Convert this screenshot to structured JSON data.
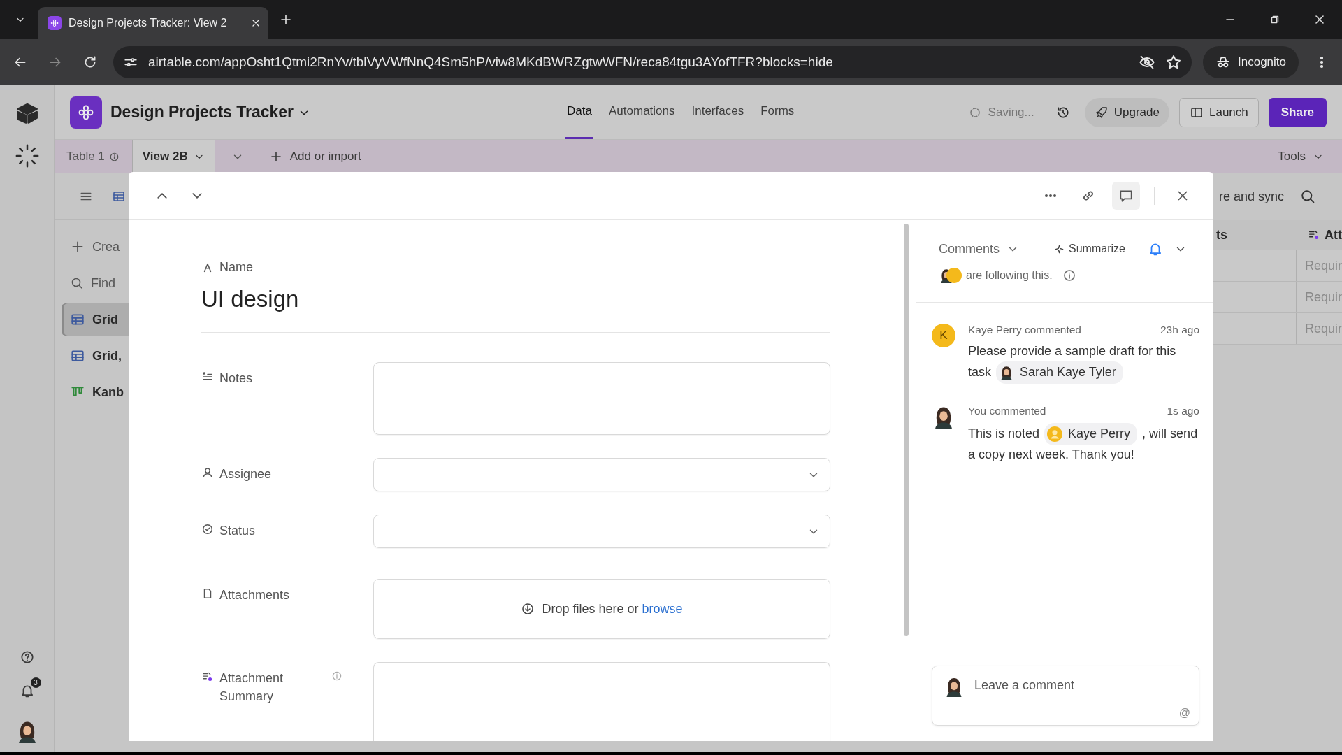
{
  "browser": {
    "tab_title": "Design Projects Tracker: View 2",
    "url": "airtable.com/appOsht1Qtmi2RnYv/tblVyVWfNnQ4Sm5hP/viw8MKdBWRZgtwWFN/reca84tgu3AYofTFR?blocks=hide",
    "profile": "Incognito"
  },
  "rail": {
    "notification_count": "3"
  },
  "app": {
    "title": "Design Projects Tracker",
    "nav": [
      {
        "label": "Data",
        "selected": true
      },
      {
        "label": "Automations",
        "selected": false
      },
      {
        "label": "Interfaces",
        "selected": false
      },
      {
        "label": "Forms",
        "selected": false
      }
    ],
    "status": "Saving...",
    "upgrade": "Upgrade",
    "launch": "Launch",
    "share": "Share"
  },
  "table_bar": {
    "table": "Table 1",
    "view": "View 2B",
    "add": "Add or import",
    "tools": "Tools"
  },
  "view_sidebar": {
    "create": "Crea",
    "find_placeholder": "Find",
    "views": [
      {
        "label": "Grid",
        "kind": "grid",
        "selected": true
      },
      {
        "label": "Grid,",
        "kind": "grid",
        "selected": false
      },
      {
        "label": "Kanb",
        "kind": "kanban",
        "selected": false
      }
    ]
  },
  "grid_behind": {
    "toolbar_text": "re and sync",
    "columns": [
      "ts",
      "Att"
    ],
    "cells": [
      "Requir",
      "Requir",
      "Requir"
    ]
  },
  "record": {
    "name_label": "Name",
    "name": "UI design",
    "fields": [
      {
        "label": "Notes",
        "kind": "long_text"
      },
      {
        "label": "Assignee",
        "kind": "user"
      },
      {
        "label": "Status",
        "kind": "status"
      },
      {
        "label": "Attachments",
        "kind": "attachment",
        "drop_text": "Drop files here or",
        "link": "browse"
      },
      {
        "label": "Attachment Summary",
        "kind": "ai_text"
      }
    ]
  },
  "comments": {
    "view": "Comments",
    "summarize": "Summarize",
    "followers": [
      {
        "kind": "photo"
      },
      {
        "kind": "blank"
      }
    ],
    "following_text": "are following this.",
    "items": [
      {
        "avatar": {
          "kind": "initial",
          "initial": "K"
        },
        "author": "Kaye Perry commented",
        "time": "23h ago",
        "before": "Please provide a sample draft for this task",
        "mention": "Sarah Kaye Tyler",
        "mention_avatar": {
          "kind": "photo"
        }
      },
      {
        "avatar": {
          "kind": "photo"
        },
        "author": "You commented",
        "time": "1s ago",
        "before": "This is noted",
        "mention": "Kaye Perry",
        "mention_avatar": {
          "kind": "placeholder"
        },
        "after": ", will send a copy next week. Thank you!"
      }
    ],
    "composer_placeholder": "Leave a comment",
    "mention_key": "@"
  }
}
